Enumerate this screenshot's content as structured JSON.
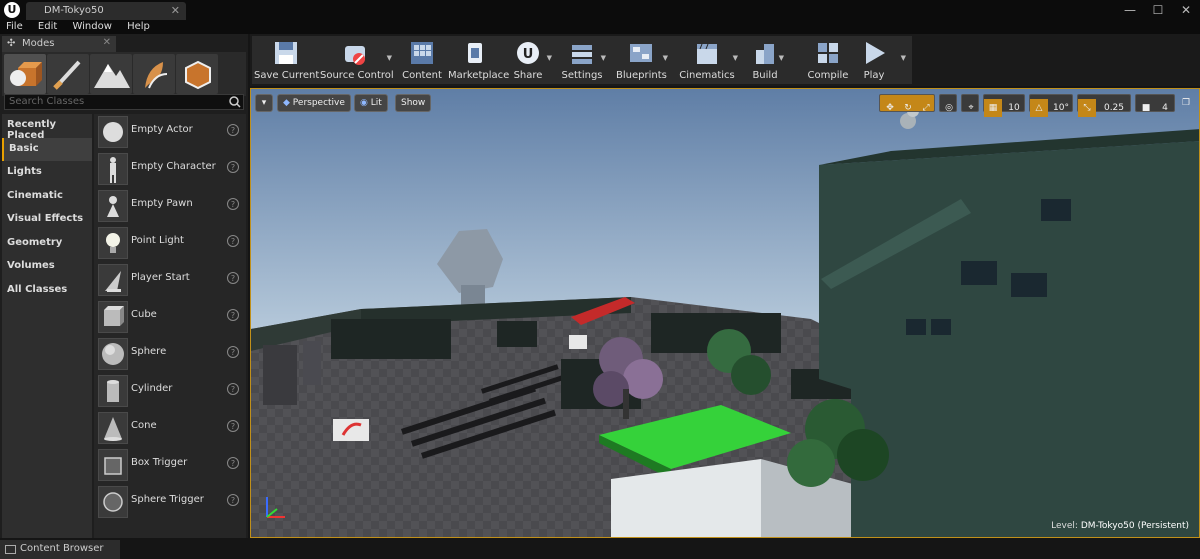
{
  "window": {
    "doc_tab": "DM-Tokyo50",
    "min": "—",
    "max": "☐",
    "close": "✕"
  },
  "menu": {
    "items": [
      "File",
      "Edit",
      "Window",
      "Help"
    ]
  },
  "modes": {
    "tab_label": "Modes",
    "search_placeholder": "Search Classes",
    "categories": [
      "Recently Placed",
      "Basic",
      "Lights",
      "Cinematic",
      "Visual Effects",
      "Geometry",
      "Volumes",
      "All Classes"
    ],
    "selected_category": "Basic",
    "items": [
      "Empty Actor",
      "Empty Character",
      "Empty Pawn",
      "Point Light",
      "Player Start",
      "Cube",
      "Sphere",
      "Cylinder",
      "Cone",
      "Box Trigger",
      "Sphere Trigger"
    ],
    "help_glyph": "?"
  },
  "toolbar": {
    "buttons": [
      "Save Current",
      "Source Control",
      "Content",
      "Marketplace",
      "Share",
      "Settings",
      "Blueprints",
      "Cinematics",
      "Build",
      "Compile",
      "Play"
    ]
  },
  "viewport": {
    "view_mode": "Perspective",
    "lighting": "Lit",
    "show": "Show",
    "grid_snap": "10",
    "rotation_snap": "10°",
    "scale_snap": "0.25",
    "camera_speed": "4",
    "level_label": "Level:",
    "level_name": "DM-Tokyo50 (Persistent)"
  },
  "content_browser": {
    "tab_label": "Content Browser"
  },
  "colors": {
    "accent": "#e8a000",
    "panel": "#262626",
    "sky_top": "#5f7ea6",
    "grass": "#35d23a"
  }
}
